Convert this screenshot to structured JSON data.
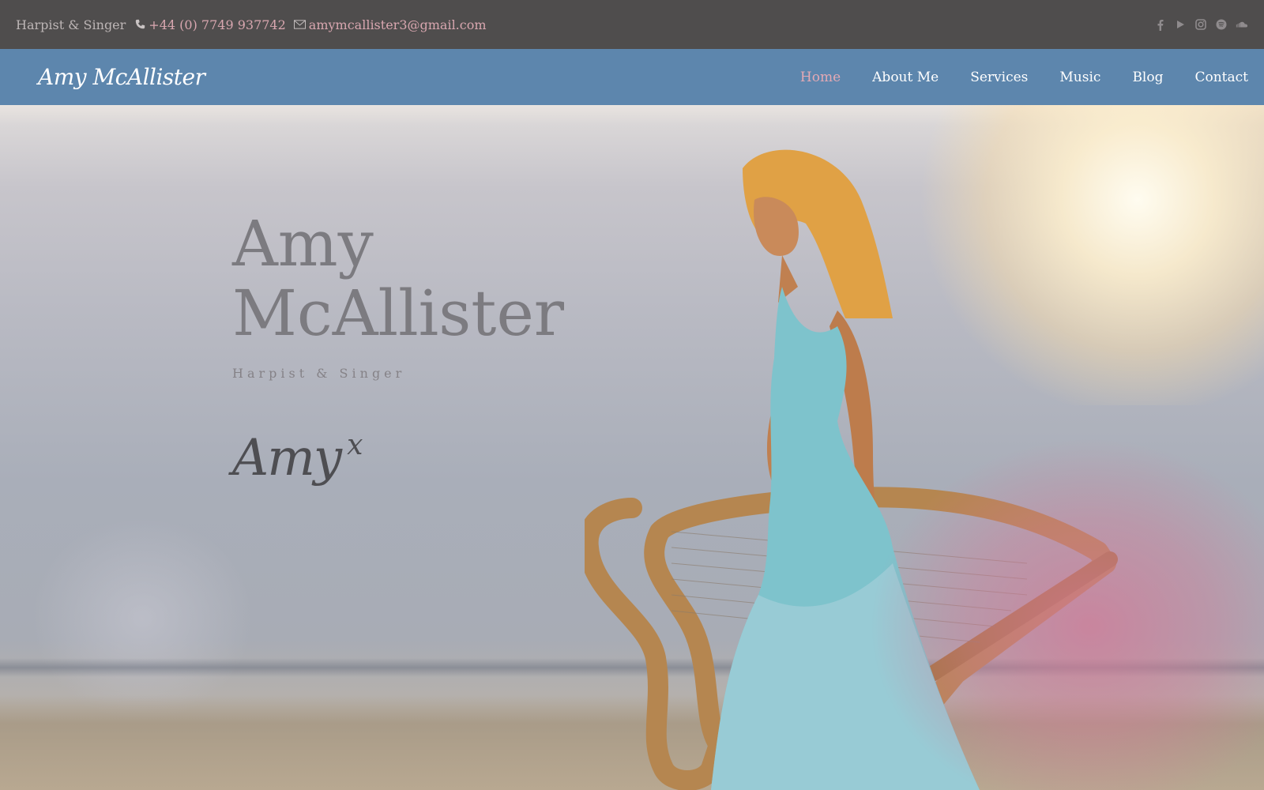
{
  "topbar": {
    "tagline": "Harpist & Singer",
    "phone": "+44 (0) 7749 937742",
    "email": "amymcallister3@gmail.com",
    "socials": [
      "facebook-icon",
      "youtube-icon",
      "instagram-icon",
      "spotify-icon",
      "soundcloud-icon"
    ]
  },
  "navbar": {
    "logo": "Amy McAllister",
    "items": [
      {
        "label": "Home",
        "active": true
      },
      {
        "label": "About Me"
      },
      {
        "label": "Services"
      },
      {
        "label": "Music"
      },
      {
        "label": "Blog"
      },
      {
        "label": "Contact"
      }
    ]
  },
  "hero": {
    "title_line1": "Amy",
    "title_line2": "McAllister",
    "subtitle": "Harpist & Singer",
    "signature": "Amy",
    "signature_mark": "x"
  },
  "colors": {
    "topbar_bg": "#4f4d4d",
    "navbar_bg": "#5d86ad",
    "accent_pink": "#e4a9b4",
    "title_gray": "#7c7b80"
  }
}
